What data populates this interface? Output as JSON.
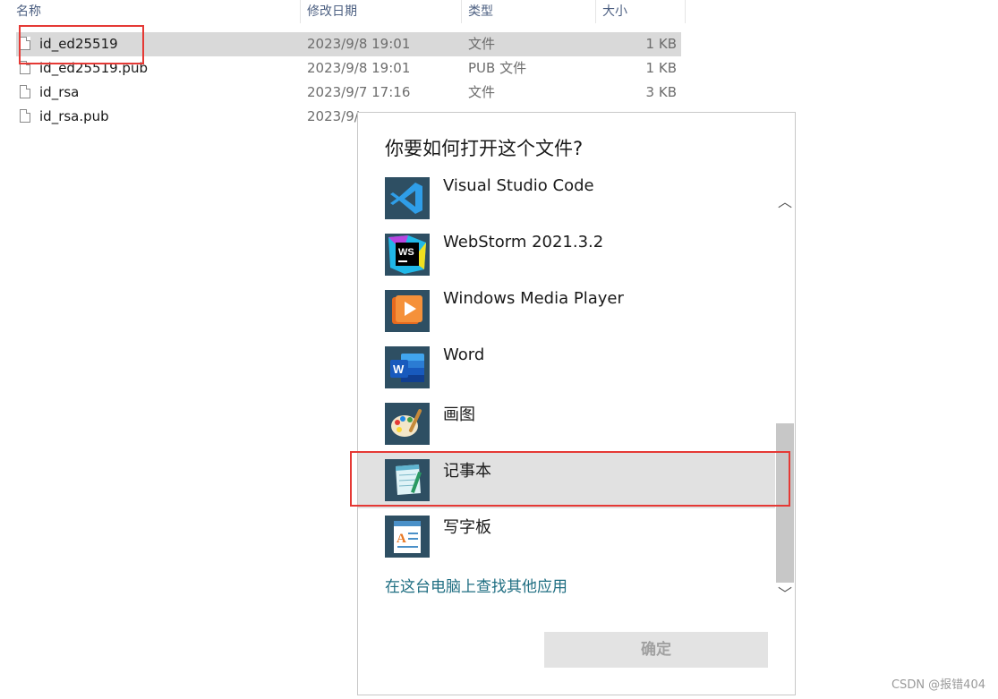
{
  "explorer": {
    "columns": {
      "name": "名称",
      "modified": "修改日期",
      "type": "类型",
      "size": "大小"
    },
    "files": [
      {
        "name": "id_ed25519",
        "modified": "2023/9/8 19:01",
        "type": "文件",
        "size": "1 KB",
        "selected": true
      },
      {
        "name": "id_ed25519.pub",
        "modified": "2023/9/8 19:01",
        "type": "PUB 文件",
        "size": "1 KB"
      },
      {
        "name": "id_rsa",
        "modified": "2023/9/7 17:16",
        "type": "文件",
        "size": "3 KB"
      },
      {
        "name": "id_rsa.pub",
        "modified": "2023/9/",
        "type": "",
        "size": ""
      }
    ]
  },
  "dialog": {
    "title": "你要如何打开这个文件?",
    "apps": [
      {
        "label": "Visual Studio Code",
        "icon": "vscode-icon"
      },
      {
        "label": "WebStorm 2021.3.2",
        "icon": "webstorm-icon"
      },
      {
        "label": "Windows Media Player",
        "icon": "media-player-icon"
      },
      {
        "label": "Word",
        "icon": "word-icon"
      },
      {
        "label": "画图",
        "icon": "paint-icon"
      },
      {
        "label": "记事本",
        "icon": "notepad-icon",
        "highlighted": true
      },
      {
        "label": "写字板",
        "icon": "wordpad-icon"
      }
    ],
    "more_apps_link": "在这台电脑上查找其他应用",
    "ok_button": "确定",
    "scroll_up": "︿",
    "scroll_down": "﹀",
    "webstorm_badge": "WS",
    "word_badge": "W"
  },
  "watermark": "CSDN @报错404",
  "colors": {
    "highlight": "#e1e1e1",
    "selection": "#d9d9d9",
    "annotation": "#e53935",
    "link": "#1f6e82",
    "icon_bg": "#2e4f63"
  }
}
